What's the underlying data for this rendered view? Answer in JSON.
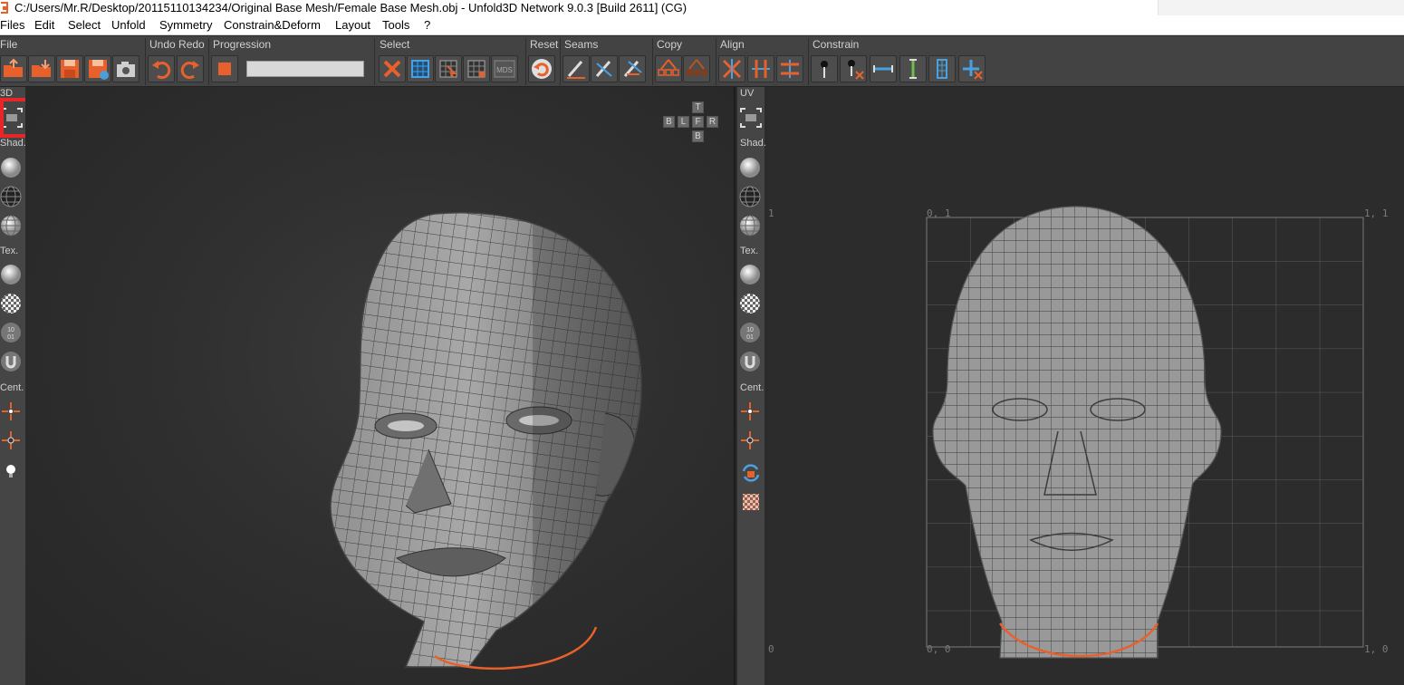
{
  "window": {
    "title": "C:/Users/Mr.R/Desktop/20115110134234/Original Base Mesh/Female Base Mesh.obj - Unfold3D Network 9.0.3 [Build 2611] (CG)"
  },
  "menu": [
    "Files",
    "Edit",
    "Select",
    "Unfold",
    "Symmetry",
    "Constrain&Deform",
    "Layout",
    "Tools",
    "?"
  ],
  "toolbar": {
    "groups": {
      "file": "File",
      "undo_redo": "Undo Redo",
      "progression": "Progression",
      "select": "Select",
      "reset": "Reset",
      "seams": "Seams",
      "copy": "Copy",
      "align": "Align",
      "constrain": "Constrain"
    },
    "icons": {
      "file": [
        "open-file-icon",
        "import-file-icon",
        "save-icon",
        "save-as-icon",
        "screenshot-camera-icon"
      ],
      "undo_redo": [
        "undo-icon",
        "redo-icon"
      ],
      "progression": [
        "stop-icon"
      ],
      "select": [
        "clear-selection-icon",
        "select-all-icon",
        "select-island-icon",
        "select-grid-icon",
        "select-mds-icon"
      ],
      "reset": [
        "reset-icon"
      ],
      "seams": [
        "cut-seam-icon",
        "weld-seam-icon",
        "auto-seam-icon"
      ],
      "copy": [
        "copy-icon",
        "paste-icon"
      ],
      "align": [
        "align-icon",
        "align-vertical-icon",
        "align-horizontal-icon"
      ],
      "constrain": [
        "pin-icon",
        "unpin-icon",
        "horizontal-constraint-icon",
        "vertical-constraint-icon",
        "lattice-constraint-icon",
        "remove-constraint-icon"
      ]
    },
    "progress": 1.0
  },
  "left_panel": {
    "viewport_label": "3D",
    "shading_label": "Shad.",
    "texture_label": "Tex.",
    "center_label": "Cent.",
    "icons": [
      "frame-view-icon",
      "shaded-sphere-icon",
      "wireframe-sphere-icon",
      "shaded-wire-sphere-icon",
      "white-sphere-icon",
      "checker-sphere-icon",
      "binary-texture-icon",
      "u-texture-icon",
      "center-icon",
      "center-selection-icon",
      "light-bulb-icon"
    ],
    "highlighted": "frame-view-icon"
  },
  "view_cube": {
    "top": "T",
    "bottom": "B",
    "back": "B",
    "left": "L",
    "front": "F",
    "right": "R"
  },
  "uv_panel": {
    "viewport_label": "UV",
    "shading_label": "Shad.",
    "texture_label": "Tex.",
    "center_label": "Cent.",
    "icons": [
      "frame-view-icon",
      "shaded-sphere-icon",
      "wireframe-sphere-icon",
      "shaded-wire-sphere-icon",
      "white-sphere-icon",
      "checker-sphere-icon",
      "binary-texture-icon",
      "u-texture-icon",
      "center-icon",
      "center-selection-icon",
      "lock-rotation-icon",
      "uv-checker-icon"
    ]
  },
  "uv_grid": {
    "top_left": "0, 1",
    "top_right": "1, 1",
    "bottom_left": "0, 0",
    "bottom_right": "1, 0",
    "left_top_tick": "1",
    "left_bottom_tick": "0"
  },
  "colors": {
    "accent": "#e8612c",
    "background": "#2b2b2b",
    "toolbar": "#434343",
    "highlight": "#e8262a",
    "mesh": "#9a9a9a"
  }
}
